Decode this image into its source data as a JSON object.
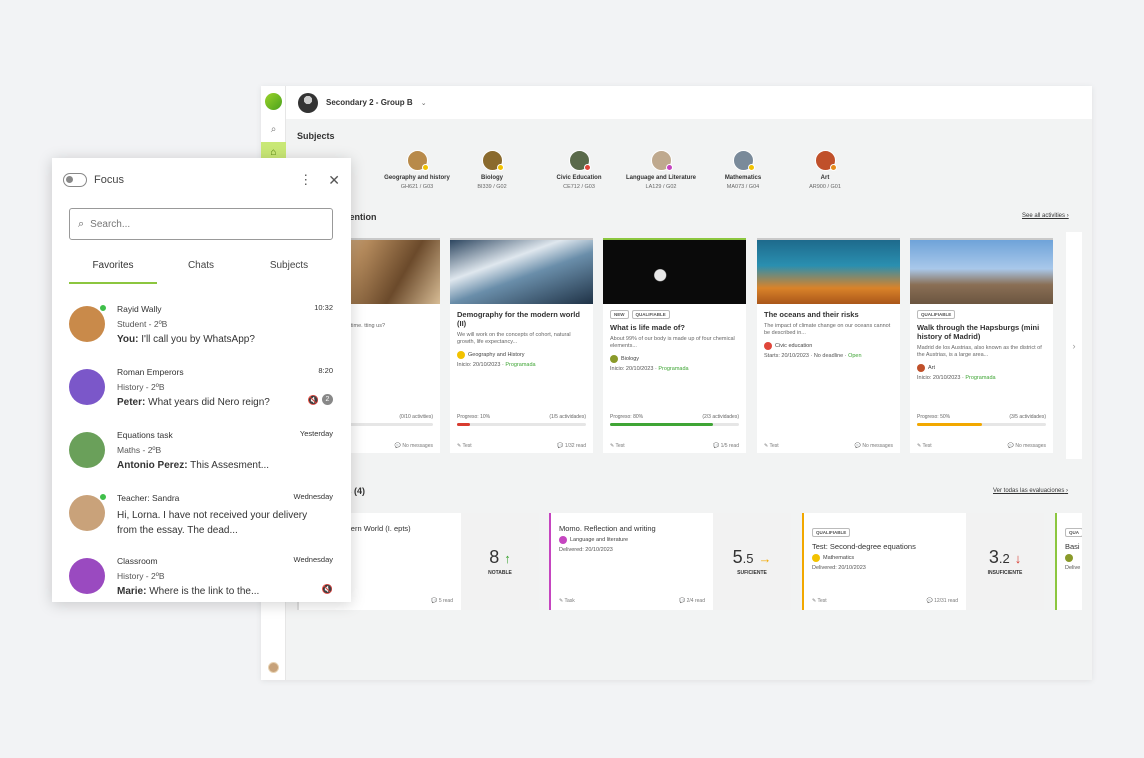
{
  "app": {
    "group": "Secondary 2 - Group B",
    "subjects_title": "Subjects",
    "subjects": [
      {
        "name": "Geography and history",
        "code": "GH621 / G03",
        "color": "#b88a4a",
        "badge": "#f2c200"
      },
      {
        "name": "Biology",
        "code": "BI339 / G02",
        "color": "#8a6a2d",
        "badge": "#f2c200"
      },
      {
        "name": "Civic Education",
        "code": "CE712 / G03",
        "color": "#5a6a4a",
        "badge": "#e0463a"
      },
      {
        "name": "Language and Literature",
        "code": "LA129 / G02",
        "color": "#bfa98e",
        "badge": "#c545c0"
      },
      {
        "name": "Mathematics",
        "code": "MA073 / G04",
        "color": "#7a8a9a",
        "badge": "#f2c200"
      },
      {
        "name": "Art",
        "code": "AR900 / G01",
        "color": "#c0502a",
        "badge": "#e58a1a"
      }
    ],
    "attention_title": "ntention",
    "see_all": "See all activities",
    "activities": [
      {
        "title": "painting",
        "desc": "tory in the art of its time. tting us?",
        "meta_start": "",
        "meta_status": "Planned",
        "progress_label": "",
        "progress_count": "(0/10 activities)",
        "progress": 0,
        "bar_color": "#ddd",
        "type": "",
        "messages": "No messages",
        "border": "#c9c9c9",
        "img": "linear-gradient(120deg,#e8d3b5,#b48a5c 40%,#6b4a2b 70%,#d7bc95)"
      },
      {
        "title": "Demography for the modern world (II)",
        "desc": "We will work on the concepts of cohort, natural growth, life expectancy...",
        "subject": "Geography and History",
        "subject_color": "#f2c200",
        "meta_start": "Inicio: 20/10/2023 · ",
        "meta_status": "Programada",
        "progress_label": "Progreso: 10%",
        "progress_count": "(1/5 actividades)",
        "progress": 0.1,
        "bar_color": "#d83b2f",
        "type": "Test",
        "messages": "1/32 read",
        "border": "#c9c9c9",
        "img": "linear-gradient(160deg,#2d4660,#dfe7ee 35%,#6a8eaa 55%,#1f3246)"
      },
      {
        "title": "What is life made of?",
        "badges": [
          "NEW",
          "QUALIFIABLE"
        ],
        "desc": "About 99% of our body is made up of four chemical elements...",
        "subject": "Biology",
        "subject_color": "#8a9a2a",
        "meta_start": "Inicio: 20/10/2023 · ",
        "meta_status": "Programada",
        "progress_label": "Progreso: 80%",
        "progress_count": "(2/3 actividades)",
        "progress": 0.8,
        "bar_color": "#3fa535",
        "type": "Test",
        "messages": "1/5 read",
        "border": "#8cc63f",
        "img": "radial-gradient(circle at 40% 55%,#e8e8e8 0 6%,#0a0a0a 7%),radial-gradient(circle at 65% 30%,#d44 0 5%,transparent 6%)"
      },
      {
        "title": "The oceans and their risks",
        "desc": "The impact of climate change on our oceans cannot be described in...",
        "subject": "Civic education",
        "subject_color": "#e0463a",
        "meta_start": "Starts: 20/10/2023 · No deadline · ",
        "meta_status": "Open",
        "progress_label": "",
        "progress_count": "",
        "progress": -1,
        "bar_color": "#ddd",
        "type": "Test",
        "messages": "No messages",
        "border": "#c9c9c9",
        "img": "linear-gradient(180deg,#1e6a8c,#2a8fb0 40%,#d9832a 75%,#a9561a)"
      },
      {
        "title": "Walk through the Hapsburgs (mini history of Madrid)",
        "badges": [
          "QUALIFIABLE"
        ],
        "desc": "Madrid de los Austrias, also known as the district of the Austrias, is a large area...",
        "subject": "Art",
        "subject_color": "#c0502a",
        "meta_start": "Inicio: 20/10/2023 · ",
        "meta_status": "Programada",
        "progress_label": "Progreso: 50%",
        "progress_count": "(3/5 actividades)",
        "progress": 0.5,
        "bar_color": "#f2a800",
        "type": "Test",
        "messages": "No messages",
        "border": "#c9c9c9",
        "img": "linear-gradient(180deg,#6fa3d9,#a9c8ea 45%,#8a6f55 70%,#6b5540)"
      }
    ],
    "evals_title": "ns (4)",
    "see_evals": "Ver todas las evaluaciones",
    "evaluations": [
      {
        "title": "y for the Modern World (I. epts)",
        "subject": "nd History",
        "date": "/2023",
        "grade_int": "8",
        "grade_dec": "",
        "arrow": "↑",
        "arrow_color": "#3fa535",
        "label": "NOTABLE",
        "type": "",
        "read": "5 read",
        "border": "#ddd"
      },
      {
        "title": "Momo. Reflection and writing",
        "subject": "Language and literature",
        "subject_color": "#c545c0",
        "date": "Delivered: 20/10/2023",
        "grade_int": "5",
        "grade_dec": ".5",
        "arrow": "→",
        "arrow_color": "#f2a800",
        "label": "SUFICIENTE",
        "type": "Task",
        "read": "2/4 read",
        "border": "#c545c0"
      },
      {
        "title": "Test: Second-degree equations",
        "badge": "QUALIFIABLE",
        "subject": "Mathematics",
        "subject_color": "#f2c200",
        "date": "Delivered: 20/10/2023",
        "grade_int": "3",
        "grade_dec": ".2",
        "arrow": "↓",
        "arrow_color": "#d83b2f",
        "label": "INSUFICIENTE",
        "type": "Test",
        "read": "12/31 read",
        "border": "#f2a800"
      },
      {
        "title": "Basi",
        "badge": "QUA",
        "subject": "",
        "subject_color": "#8a9a2a",
        "date": "Delive",
        "grade_int": "",
        "grade_dec": "",
        "arrow": "",
        "arrow_color": "#333",
        "label": "",
        "type": "",
        "read": "",
        "border": "#8cc63f"
      }
    ]
  },
  "popup": {
    "focus_label": "Focus",
    "search_placeholder": "Search...",
    "tabs": [
      "Favorites",
      "Chats",
      "Subjects"
    ],
    "chats": [
      {
        "line1": "Rayid Wally",
        "line2": "Student - 2ºB",
        "sender": "You:",
        "message": " I'll call you by WhatsApp?",
        "time": "10:32",
        "avatar": "#c98a4a",
        "online": true
      },
      {
        "line1": "Roman Emperors",
        "line2": "History - 2ºB",
        "sender": "Peter:",
        "message": " What years did Nero reign?",
        "time": "8:20",
        "avatar": "#7b57c9",
        "count": "2"
      },
      {
        "line1": "Equations task",
        "line2": "Maths - 2ºB",
        "sender": "Antonio Perez:",
        "message": " This Assesment...",
        "time": "Yesterday",
        "avatar": "#6aa05a"
      },
      {
        "line1": "Teacher: Sandra",
        "text": "Hi, Lorna. I have not received your delivery from the essay. The dead...",
        "time": "Wednesday",
        "avatar": "#c9a27a",
        "online": true
      },
      {
        "line1": "Classroom",
        "line2": "History - 2ºB",
        "sender": "Marie:",
        "message": " Where is the link to the...",
        "time": "Wednesday",
        "avatar": "#9a4ac0"
      }
    ]
  }
}
